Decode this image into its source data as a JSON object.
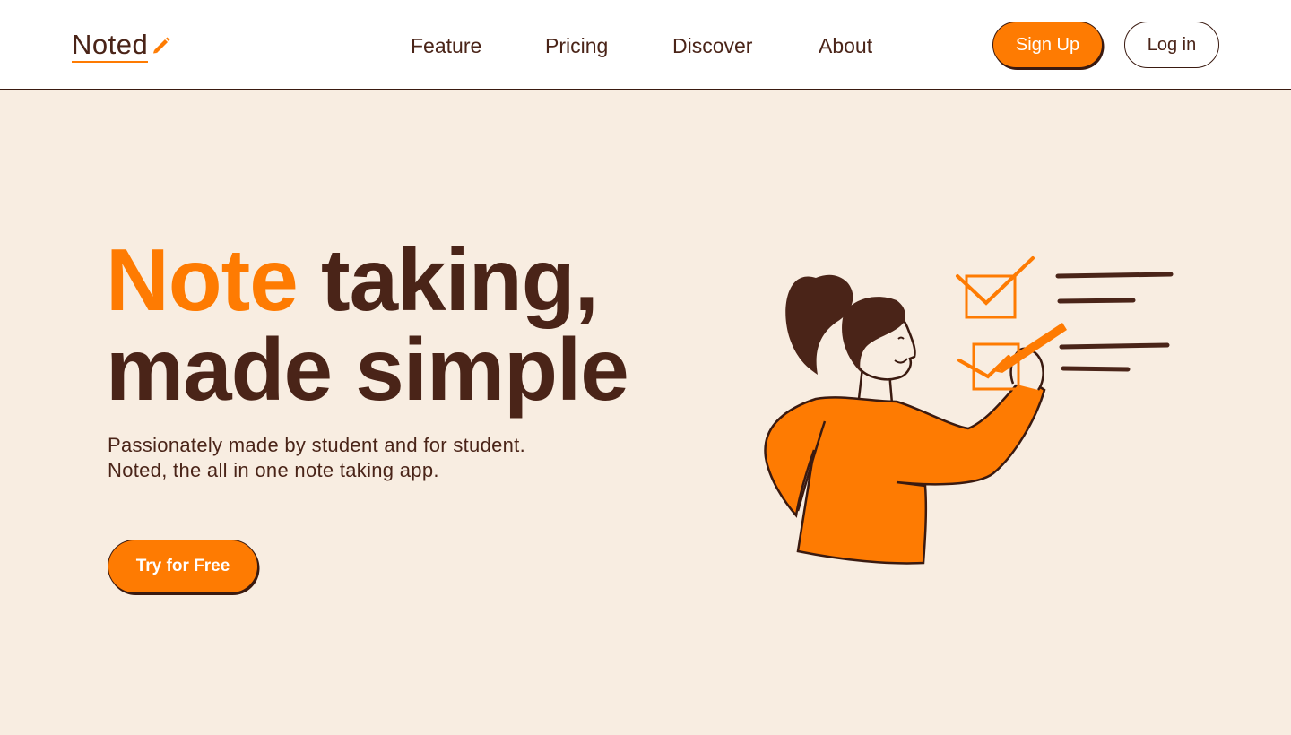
{
  "header": {
    "logo_text": "Noted",
    "logo_icon": "pencil-icon",
    "nav": [
      {
        "label": "Feature"
      },
      {
        "label": "Pricing"
      },
      {
        "label": "Discover"
      },
      {
        "label": "About"
      }
    ],
    "signup_label": "Sign Up",
    "login_label": "Log in"
  },
  "hero": {
    "title_accent": "Note",
    "title_rest_line1": " taking,",
    "title_line2": "made simple",
    "subtitle_line1": "Passionately made by student and for student.",
    "subtitle_line2": "Noted, the all in one note taking app.",
    "cta_label": "Try for Free",
    "illustration": "woman-checking-list-illustration"
  },
  "colors": {
    "accent": "#fe7b02",
    "text": "#4a2418",
    "background": "#f8ede1",
    "header_bg": "#ffffff"
  }
}
